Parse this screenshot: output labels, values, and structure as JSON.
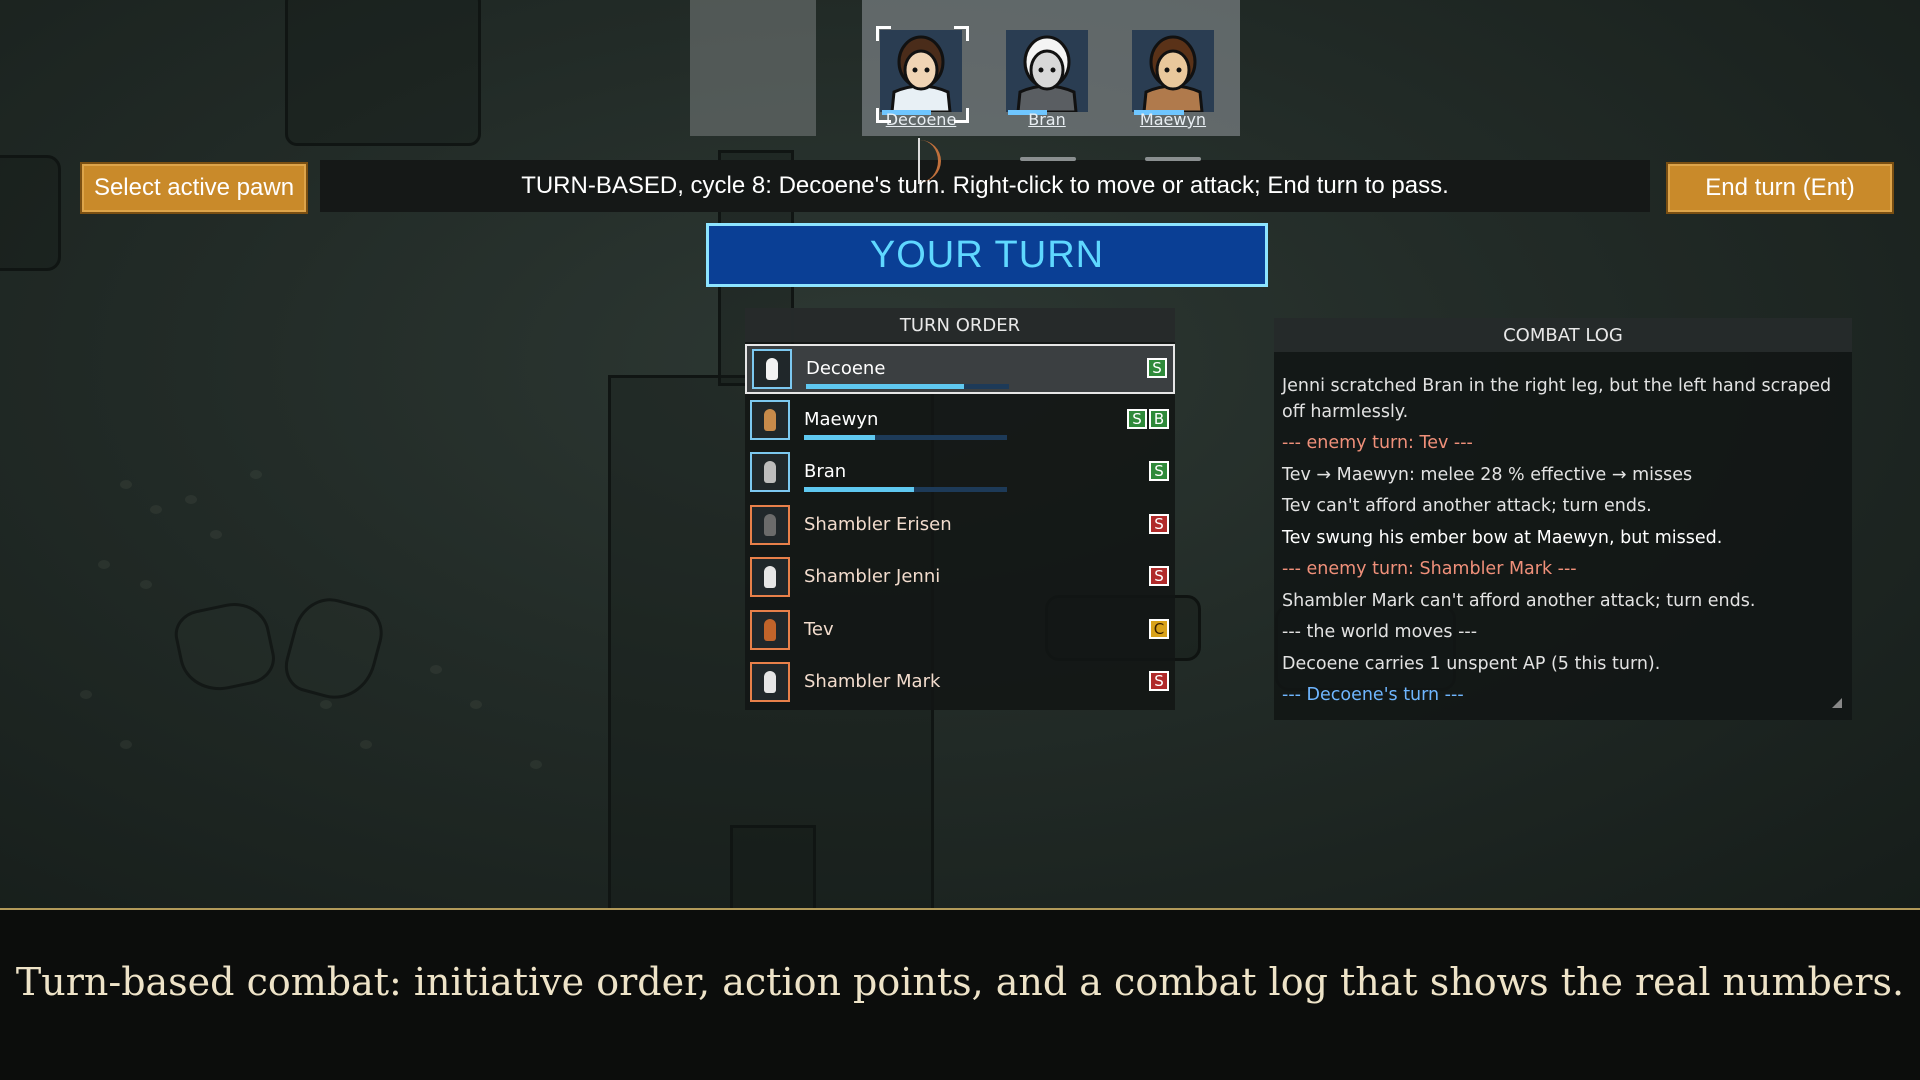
{
  "colonist_bar": {
    "colonists": [
      {
        "name": "Decoene",
        "selected": true,
        "skin": "#f0d4b4",
        "hair": "#4a2c1a",
        "clothes": "#e8f0f5",
        "hp": 0.7
      },
      {
        "name": "Bran",
        "selected": false,
        "skin": "#d8d8d8",
        "hair": "#f4f4f4",
        "clothes": "#5a5e62",
        "hp": 0.55
      },
      {
        "name": "Maewyn",
        "selected": false,
        "skin": "#e9c89c",
        "hair": "#5a3218",
        "clothes": "#b07a4c",
        "hp": 0.72
      }
    ]
  },
  "controls": {
    "select_pawn_label": "Select active pawn",
    "status_text": "TURN-BASED, cycle 8: Decoene's turn. Right-click to move or attack; End turn to pass.",
    "end_turn_label": "End turn (Ent)",
    "your_turn_label": "YOUR TURN"
  },
  "turn_order": {
    "title": "TURN ORDER",
    "entries": [
      {
        "name": "Decoene",
        "faction": "ally",
        "active": true,
        "hp": 0.78,
        "fig": "#f2f2f2",
        "badges": [
          {
            "letter": "S",
            "kind": "green"
          }
        ]
      },
      {
        "name": "Maewyn",
        "faction": "ally",
        "active": false,
        "hp": 0.35,
        "fig": "#c78a4a",
        "badges": [
          {
            "letter": "S",
            "kind": "green"
          },
          {
            "letter": "B",
            "kind": "green"
          }
        ]
      },
      {
        "name": "Bran",
        "faction": "ally",
        "active": false,
        "hp": 0.54,
        "fig": "#bdbdbd",
        "badges": [
          {
            "letter": "S",
            "kind": "green"
          }
        ]
      },
      {
        "name": "Shambler Erisen",
        "faction": "enemy",
        "active": false,
        "hp": null,
        "fig": "#6b6b6b",
        "badges": [
          {
            "letter": "S",
            "kind": "red"
          }
        ]
      },
      {
        "name": "Shambler Jenni",
        "faction": "enemy",
        "active": false,
        "hp": null,
        "fig": "#e6e6e6",
        "badges": [
          {
            "letter": "S",
            "kind": "red"
          }
        ]
      },
      {
        "name": "Tev",
        "faction": "enemy",
        "active": false,
        "hp": null,
        "fig": "#c2642a",
        "badges": [
          {
            "letter": "C",
            "kind": "yellow"
          }
        ]
      },
      {
        "name": "Shambler Mark",
        "faction": "enemy",
        "active": false,
        "hp": null,
        "fig": "#e6e6e6",
        "badges": [
          {
            "letter": "S",
            "kind": "red"
          }
        ]
      }
    ]
  },
  "combat_log": {
    "title": "COMBAT LOG",
    "lines": [
      {
        "text": "Jenni scratched Bran in the right leg, but the left hand scraped off harmlessly.",
        "kind": "normal"
      },
      {
        "text": "--- enemy turn: Tev ---",
        "kind": "enemy"
      },
      {
        "text": "Tev → Maewyn: melee 28 % effective → misses",
        "kind": "normal"
      },
      {
        "text": "Tev can't afford another attack; turn ends.",
        "kind": "normal"
      },
      {
        "text": "Tev swung his ember bow at Maewyn, but missed.",
        "kind": "bright"
      },
      {
        "text": "--- enemy turn: Shambler Mark ---",
        "kind": "enemy"
      },
      {
        "text": "Shambler Mark can't afford another attack; turn ends.",
        "kind": "normal"
      },
      {
        "text": "--- the world moves ---",
        "kind": "normal"
      },
      {
        "text": "Decoene carries 1 unspent AP (5 this turn).",
        "kind": "normal"
      },
      {
        "text": "--- Decoene's turn ---",
        "kind": "ally"
      }
    ]
  },
  "caption": "Turn-based combat: initiative order, action points, and a combat log that shows the real numbers.",
  "colors": {
    "ally_border": "#7cc8f0",
    "enemy_border": "#e8804a",
    "badge_green": "#2f8a3a",
    "badge_red": "#b02a2a",
    "badge_yellow": "#d9a21a",
    "log_enemy": "#f0907a",
    "log_ally": "#6fb6ff"
  }
}
